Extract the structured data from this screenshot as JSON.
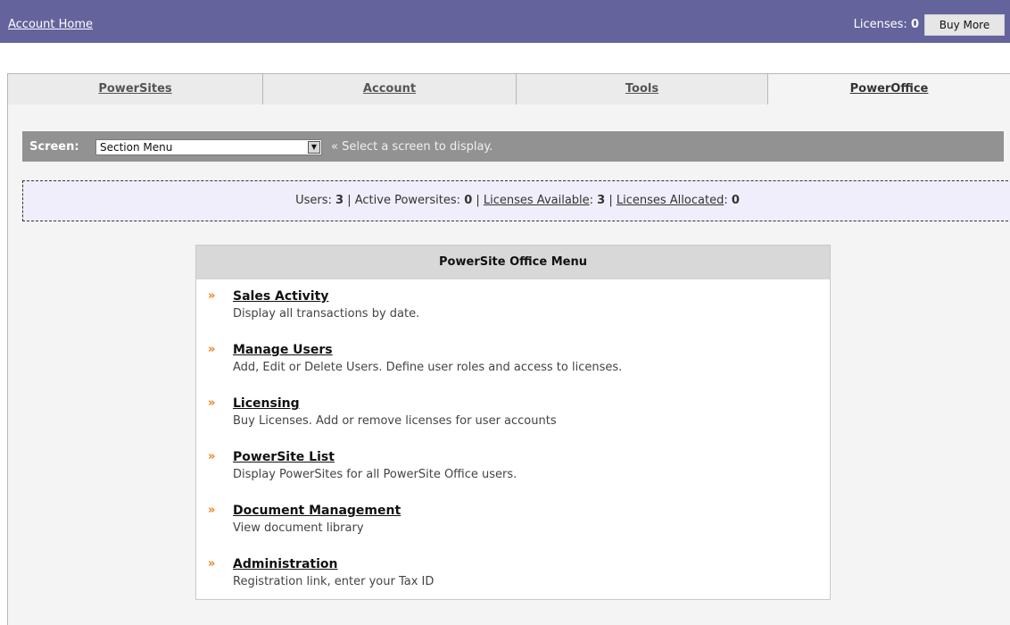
{
  "header": {
    "account_home": "Account Home",
    "licenses_label": "Licenses:",
    "licenses_value": "0",
    "buy_more": "Buy More"
  },
  "tabs": [
    {
      "label": "PowerSites"
    },
    {
      "label": "Account"
    },
    {
      "label": "Tools"
    },
    {
      "label": "PowerOffice",
      "active": true
    }
  ],
  "screen": {
    "label": "Screen:",
    "selected": "Section Menu",
    "hint": "« Select a screen to display."
  },
  "stats": {
    "users_label": "Users:",
    "users_value": "3",
    "active_label": "Active Powersites:",
    "active_value": "0",
    "avail_label": "Licenses Available",
    "avail_value": "3",
    "alloc_label": "Licenses Allocated",
    "alloc_value": "0"
  },
  "menu": {
    "title": "PowerSite Office Menu",
    "items": [
      {
        "title": "Sales Activity",
        "desc": "Display all transactions by date."
      },
      {
        "title": "Manage Users",
        "desc": "Add, Edit or Delete Users. Define user roles and access to licenses."
      },
      {
        "title": "Licensing",
        "desc": "Buy Licenses. Add or remove licenses for user accounts"
      },
      {
        "title": "PowerSite List",
        "desc": "Display PowerSites for all PowerSite Office users."
      },
      {
        "title": "Document Management",
        "desc": "View document library"
      },
      {
        "title": "Administration",
        "desc": "Registration link, enter your Tax ID"
      }
    ],
    "bullet": "»"
  },
  "colors": {
    "topbar": "#64639c",
    "bullet": "#f07f1a",
    "screenbar": "#929292"
  }
}
